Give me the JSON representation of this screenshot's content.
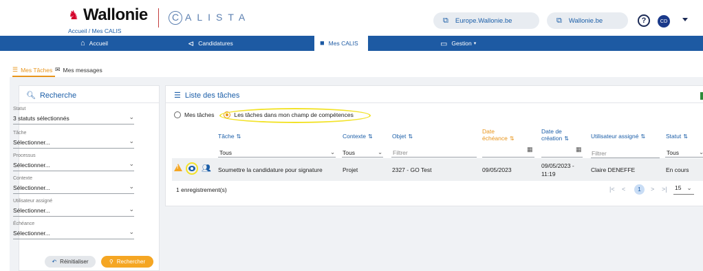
{
  "header": {
    "brand": "Wallonie",
    "breadcrumb": "Accueil / Mes CALIS",
    "app_name": "ALISTA",
    "app_initial": "C",
    "links": [
      {
        "label": "Europe.Wallonie.be"
      },
      {
        "label": "Wallonie.be"
      }
    ],
    "help": "?",
    "user_initials": "CD"
  },
  "nav": {
    "items": [
      {
        "label": "Accueil"
      },
      {
        "label": "Candidatures"
      },
      {
        "label": "Mes CALIS"
      },
      {
        "label": "Gestion"
      }
    ],
    "active_index": 2
  },
  "tabs": {
    "items": [
      {
        "label": "Mes Tâches"
      },
      {
        "label": "Mes messages"
      }
    ]
  },
  "search": {
    "title": "Recherche",
    "fields": [
      {
        "label": "Statut",
        "value": "3 statuts sélectionnés"
      },
      {
        "label": "Tâche",
        "value": "Sélectionner..."
      },
      {
        "label": "Processus",
        "value": "Sélectionner..."
      },
      {
        "label": "Contexte",
        "value": "Sélectionner..."
      },
      {
        "label": "Utilisateur assigné",
        "value": "Sélectionner..."
      },
      {
        "label": "Échéance",
        "value": "Sélectionner..."
      }
    ],
    "reset_label": "Réinitialiser",
    "search_label": "Rechercher"
  },
  "tasks": {
    "title": "Liste des tâches",
    "radio_mine": "Mes tâches",
    "radio_scope": "Les tâches dans mon champ de compétences",
    "columns": {
      "task": "Tâche",
      "context": "Contexte",
      "object": "Objet",
      "due_1": "Date",
      "due_2": "échéance",
      "created_1": "Date de",
      "created_2": "création",
      "assignee": "Utilisateur assigné",
      "status": "Statut"
    },
    "filters": {
      "task": "Tous",
      "context": "Tous",
      "object": "Filtrer",
      "assignee": "Filtrer",
      "status": "Tous"
    },
    "rows": [
      {
        "task": "Soumettre la candidature pour signature",
        "context": "Projet",
        "object": "2327 - GO Test",
        "due": "09/05/2023",
        "created_1": "09/05/2023 -",
        "created_2": "11:19",
        "assignee": "Claire DENEFFE",
        "status": "En cours"
      }
    ],
    "record_count": "1 enregistrement(s)",
    "current_page": "1",
    "page_size": "15"
  },
  "colors": {
    "nav_blue": "#1d5aa3",
    "accent_orange": "#e8941a",
    "highlight_yellow": "#f2e227"
  }
}
